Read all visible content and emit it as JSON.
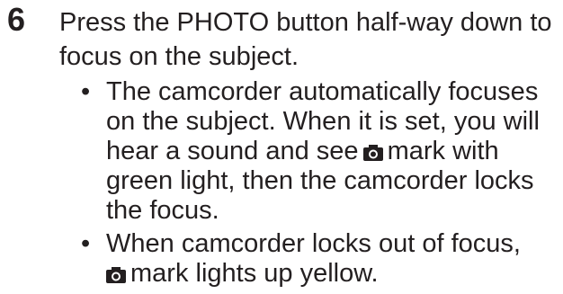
{
  "step": {
    "number": "6",
    "title": "Press the PHOTO button half-way down to focus on the subject."
  },
  "bullets": [
    {
      "marker": "•",
      "text_before": "The camcorder automatically focuses on the subject. When it is set, you will hear a sound and see",
      "icon": "camera-icon",
      "text_after": "mark with green light, then the camcorder locks the focus."
    },
    {
      "marker": "•",
      "text_before": "When camcorder locks out of focus,",
      "icon": "camera-icon",
      "text_after": "mark lights up yellow."
    }
  ],
  "colors": {
    "text": "#231f20",
    "icon": "#231f20"
  }
}
